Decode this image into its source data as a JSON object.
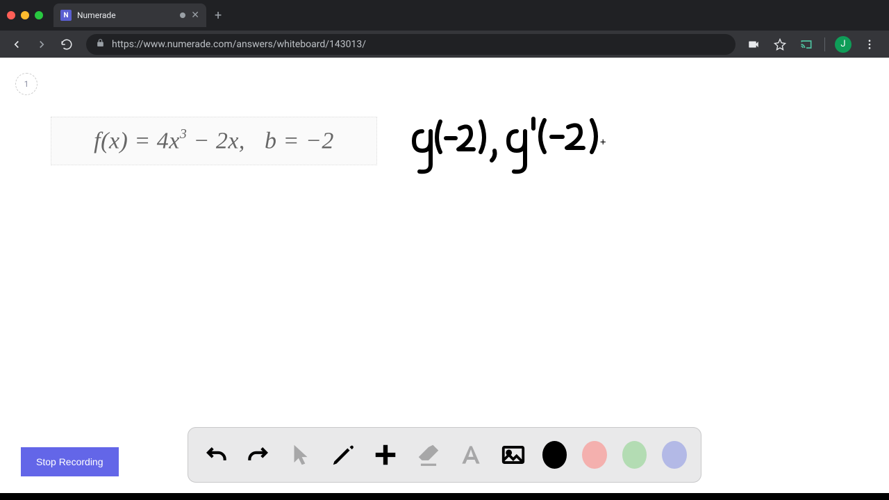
{
  "window": {
    "tab_title": "Numerade",
    "url": "https://www.numerade.com/answers/whiteboard/143013/",
    "url_prefix": "https",
    "url_host_path": "://www.numerade.com/answers/whiteboard/143013/",
    "favicon_letter": "N",
    "avatar_letter": "J"
  },
  "whiteboard": {
    "page_number": "1",
    "formula_text": "f(x) = 4x³ − 2x,    b = −2",
    "handwriting_text": "g(-2), g'(-2)",
    "crosshair": "+"
  },
  "controls": {
    "stop_label": "Stop Recording"
  },
  "tools": {
    "undo": "undo",
    "redo": "redo",
    "pointer": "pointer",
    "pen": "pen",
    "add": "add",
    "eraser": "eraser",
    "text": "text",
    "image": "image"
  },
  "colors": {
    "black": "#000000",
    "red": "#f4b0ae",
    "green": "#b3dcb3",
    "blue": "#b3b9e6"
  }
}
